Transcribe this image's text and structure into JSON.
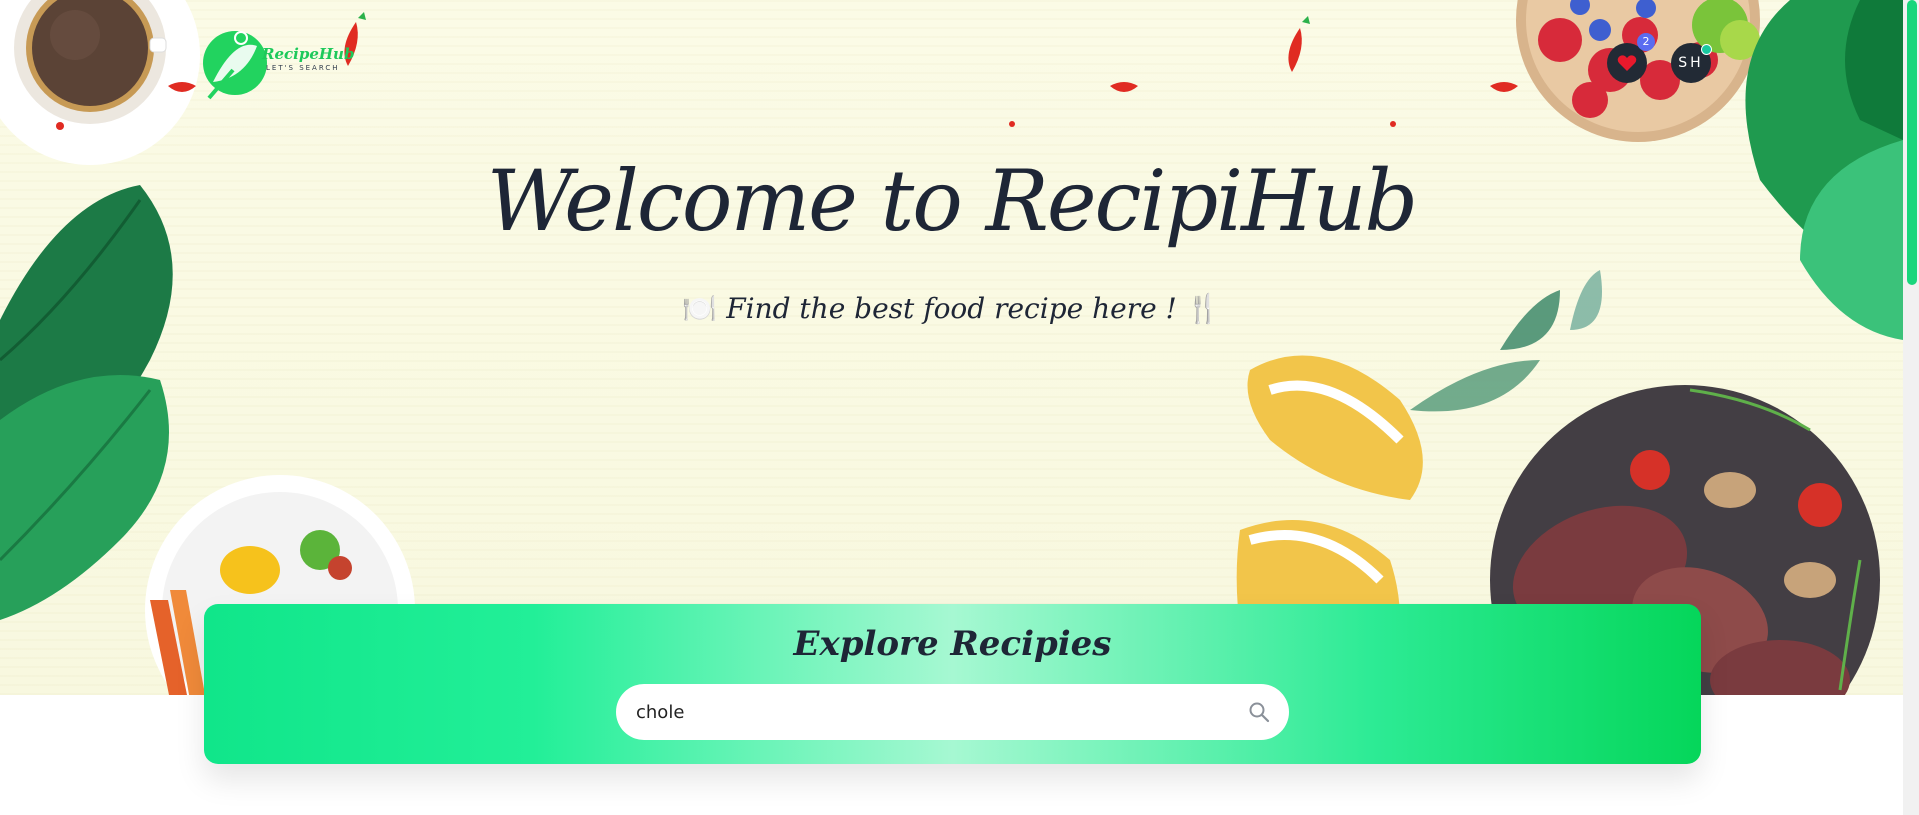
{
  "app": {
    "logo_name": "RecipeHub",
    "logo_tagline": "LET'S SEARCH"
  },
  "header": {
    "favorites_count": "2",
    "user_initials": "SH"
  },
  "hero": {
    "title": "Welcome to RecipiHub",
    "subtitle_prefix_icon": "🍽️",
    "subtitle": "Find the best food recipe here !",
    "subtitle_suffix_icon": "🍴"
  },
  "search": {
    "title": "Explore Recipies",
    "value": "chole",
    "placeholder": ""
  },
  "colors": {
    "accent": "#1dc95a",
    "dark": "#1e2636",
    "badge": "#5a6cf0",
    "heart": "#e8192c"
  }
}
